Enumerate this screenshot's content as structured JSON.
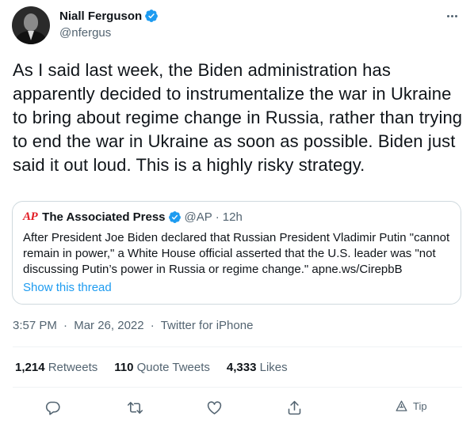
{
  "author": {
    "display_name": "Niall Ferguson",
    "handle": "@nfergus",
    "verified": true
  },
  "tweet_text": "As I said last week, the Biden administration has apparently decided to instrumentalize the war in Ukraine to bring about regime change in Russia, rather than trying to end the war in Ukraine as soon as possible. Biden just said it out loud. This is a highly risky strategy.",
  "quoted_tweet": {
    "logo_text": "AP",
    "display_name": "The Associated Press",
    "handle": "@AP",
    "separator": "·",
    "age": "12h",
    "text": "After President Joe Biden declared that Russian President Vladimir Putin \"cannot remain in power,\" a White House official asserted that the U.S. leader was \"not discussing Putin’s power in Russia or regime change.\" apne.ws/CirepbB",
    "thread_link": "Show this thread"
  },
  "timestamp": {
    "time": "3:57 PM",
    "date": "Mar 26, 2022",
    "source": "Twitter for iPhone",
    "separator": "·"
  },
  "stats": {
    "retweets_count": "1,214",
    "retweets_label": "Retweets",
    "quotes_count": "110",
    "quotes_label": "Quote Tweets",
    "likes_count": "4,333",
    "likes_label": "Likes"
  },
  "actions": {
    "tip_label": "Tip"
  },
  "colors": {
    "accent": "#1d9bf0",
    "text": "#0f1419",
    "secondary": "#536471",
    "border": "#cfd9de",
    "ap_red": "#e21b23"
  }
}
